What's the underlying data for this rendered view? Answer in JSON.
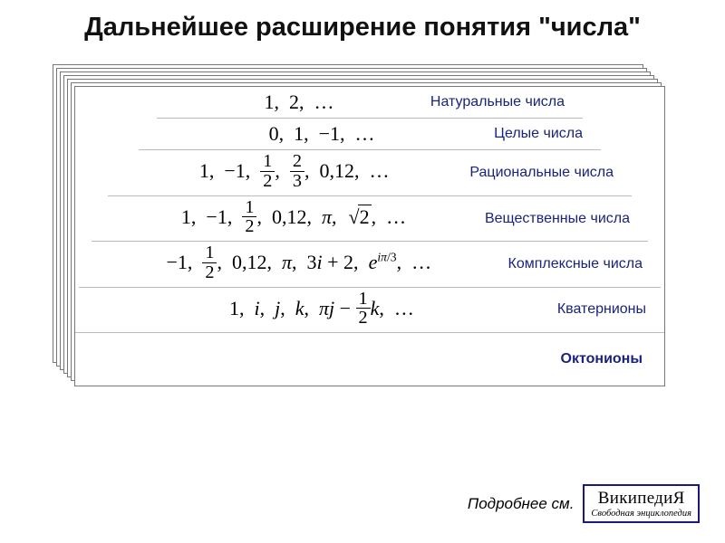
{
  "title": "Дальнейшее расширение понятия \"числа\"",
  "rows": [
    {
      "label": "Натуральные числа"
    },
    {
      "label": "Целые числа"
    },
    {
      "label": "Рациональные числа"
    },
    {
      "label": "Вещественные числа"
    },
    {
      "label": "Комплексные числа"
    },
    {
      "label": "Кватернионы"
    }
  ],
  "formulas": {
    "natural": "1,  2,  …",
    "integer": "0,  1,  −1,  …",
    "rational": "1,  −1,  1/2,  2/3,  0,12,  …",
    "real": "1,  −1,  1/2,  0,12,  π,  √2,  …",
    "complex": "−1,  1/2,  0,12,  π,  3i + 2,  e^{iπ/3},  …",
    "quaternion": "1,  i,  j,  k,  πj − (1/2)k,  …"
  },
  "octonions": "Октонионы",
  "footer": {
    "see_more": "Подробнее см.",
    "wiki_title": "ВикипедиЯ",
    "wiki_sub": "Свободная энциклопедия"
  }
}
